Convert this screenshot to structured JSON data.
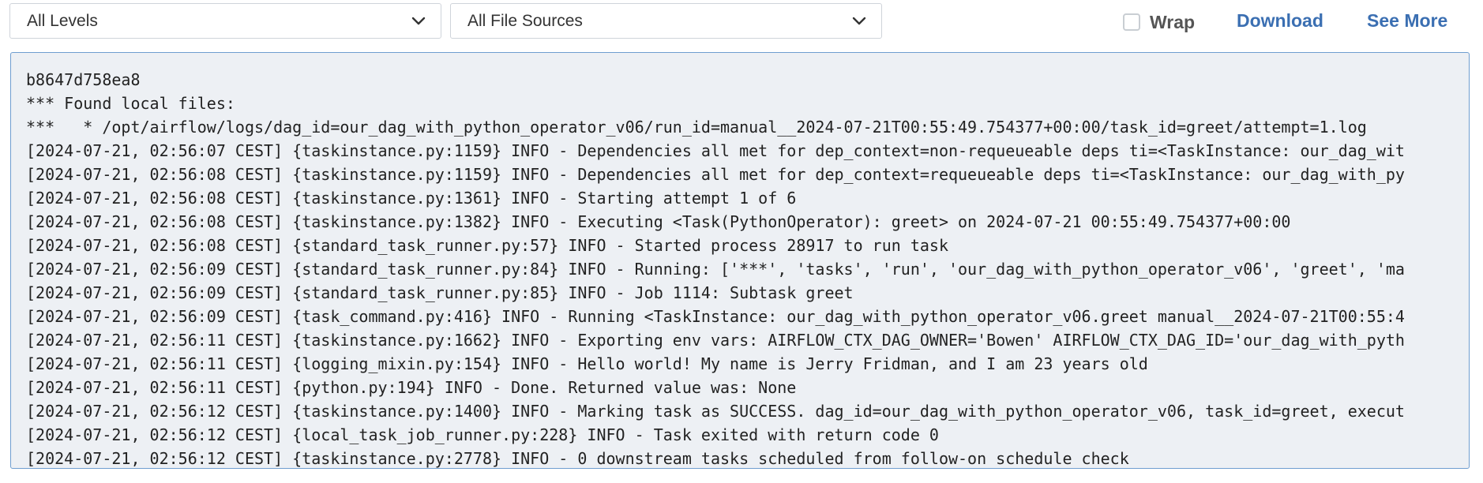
{
  "toolbar": {
    "level_filter": "All Levels",
    "source_filter": "All File Sources",
    "wrap_label": "Wrap",
    "wrap_checked": false,
    "download_label": "Download",
    "see_more_label": "See More"
  },
  "log": {
    "lines": [
      "b8647d758ea8",
      "*** Found local files:",
      "***   * /opt/airflow/logs/dag_id=our_dag_with_python_operator_v06/run_id=manual__2024-07-21T00:55:49.754377+00:00/task_id=greet/attempt=1.log",
      "[2024-07-21, 02:56:07 CEST] {taskinstance.py:1159} INFO - Dependencies all met for dep_context=non-requeueable deps ti=<TaskInstance: our_dag_wit",
      "[2024-07-21, 02:56:08 CEST] {taskinstance.py:1159} INFO - Dependencies all met for dep_context=requeueable deps ti=<TaskInstance: our_dag_with_py",
      "[2024-07-21, 02:56:08 CEST] {taskinstance.py:1361} INFO - Starting attempt 1 of 6",
      "[2024-07-21, 02:56:08 CEST] {taskinstance.py:1382} INFO - Executing <Task(PythonOperator): greet> on 2024-07-21 00:55:49.754377+00:00",
      "[2024-07-21, 02:56:08 CEST] {standard_task_runner.py:57} INFO - Started process 28917 to run task",
      "[2024-07-21, 02:56:09 CEST] {standard_task_runner.py:84} INFO - Running: ['***', 'tasks', 'run', 'our_dag_with_python_operator_v06', 'greet', 'ma",
      "[2024-07-21, 02:56:09 CEST] {standard_task_runner.py:85} INFO - Job 1114: Subtask greet",
      "[2024-07-21, 02:56:09 CEST] {task_command.py:416} INFO - Running <TaskInstance: our_dag_with_python_operator_v06.greet manual__2024-07-21T00:55:4",
      "[2024-07-21, 02:56:11 CEST] {taskinstance.py:1662} INFO - Exporting env vars: AIRFLOW_CTX_DAG_OWNER='Bowen' AIRFLOW_CTX_DAG_ID='our_dag_with_pyth",
      "[2024-07-21, 02:56:11 CEST] {logging_mixin.py:154} INFO - Hello world! My name is Jerry Fridman, and I am 23 years old",
      "[2024-07-21, 02:56:11 CEST] {python.py:194} INFO - Done. Returned value was: None",
      "[2024-07-21, 02:56:12 CEST] {taskinstance.py:1400} INFO - Marking task as SUCCESS. dag_id=our_dag_with_python_operator_v06, task_id=greet, execut",
      "[2024-07-21, 02:56:12 CEST] {local_task_job_runner.py:228} INFO - Task exited with return code 0",
      "[2024-07-21, 02:56:12 CEST] {taskinstance.py:2778} INFO - 0 downstream tasks scheduled from follow-on schedule check"
    ]
  },
  "icons": {
    "dropdown": "chevron-down-icon",
    "checkbox": "checkbox-unchecked-icon"
  },
  "colors": {
    "link": "#3b6fb2",
    "log_background": "#edf0f4",
    "log_border": "#6f9ed0"
  }
}
